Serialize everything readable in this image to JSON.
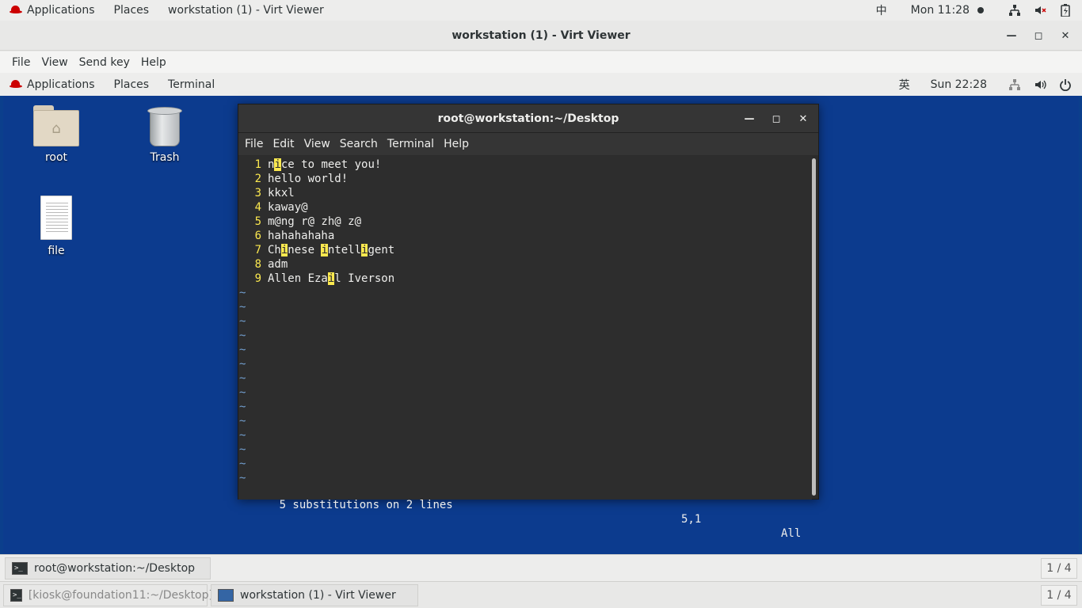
{
  "host_topbar": {
    "applications": "Applications",
    "places": "Places",
    "window_label": "workstation (1) - Virt Viewer",
    "input_method": "中",
    "clock": "Mon 11:28"
  },
  "viewer": {
    "title": "workstation (1) - Virt Viewer",
    "menu": [
      "File",
      "View",
      "Send key",
      "Help"
    ]
  },
  "guest_topbar": {
    "applications": "Applications",
    "places": "Places",
    "app": "Terminal",
    "input_method": "英",
    "clock": "Sun 22:28"
  },
  "desktop_icons": {
    "root": "root",
    "trash": "Trash",
    "file": "file"
  },
  "terminal": {
    "title": "root@workstation:~/Desktop",
    "menu": [
      "File",
      "Edit",
      "View",
      "Search",
      "Terminal",
      "Help"
    ],
    "lines": [
      {
        "n": "1",
        "segments": [
          [
            "n",
            false
          ],
          [
            "i",
            true
          ],
          [
            "ce to meet you!",
            false
          ]
        ]
      },
      {
        "n": "2",
        "segments": [
          [
            "hello world!",
            false
          ]
        ]
      },
      {
        "n": "3",
        "segments": [
          [
            "kkxl",
            false
          ]
        ]
      },
      {
        "n": "4",
        "segments": [
          [
            "kaway@",
            false
          ]
        ]
      },
      {
        "n": "5",
        "segments": [
          [
            "m@ng r@ zh@ z@",
            false
          ]
        ]
      },
      {
        "n": "6",
        "segments": [
          [
            "hahahahaha",
            false
          ]
        ]
      },
      {
        "n": "7",
        "segments": [
          [
            "Ch",
            false
          ],
          [
            "i",
            true
          ],
          [
            "nese ",
            false
          ],
          [
            "i",
            true
          ],
          [
            "ntell",
            false
          ],
          [
            "i",
            true
          ],
          [
            "gent",
            false
          ]
        ]
      },
      {
        "n": "8",
        "segments": [
          [
            "adm",
            false
          ]
        ]
      },
      {
        "n": "9",
        "segments": [
          [
            "Allen Eza",
            false
          ],
          [
            "i",
            true
          ],
          [
            "l Iverson",
            false
          ]
        ]
      }
    ],
    "tilde_count": 14,
    "tilde": "~",
    "status_message": "5 substitutions on 2 lines",
    "cursor_pos": "5,1",
    "scroll_pos": "All"
  },
  "guest_taskbar": {
    "task": "root@workstation:~/Desktop",
    "pager": "1 / 4"
  },
  "host_taskbar": {
    "task1": "[kiosk@foundation11:~/Desktop]",
    "task2": "workstation (1) - Virt Viewer",
    "pager": "1 / 4"
  }
}
